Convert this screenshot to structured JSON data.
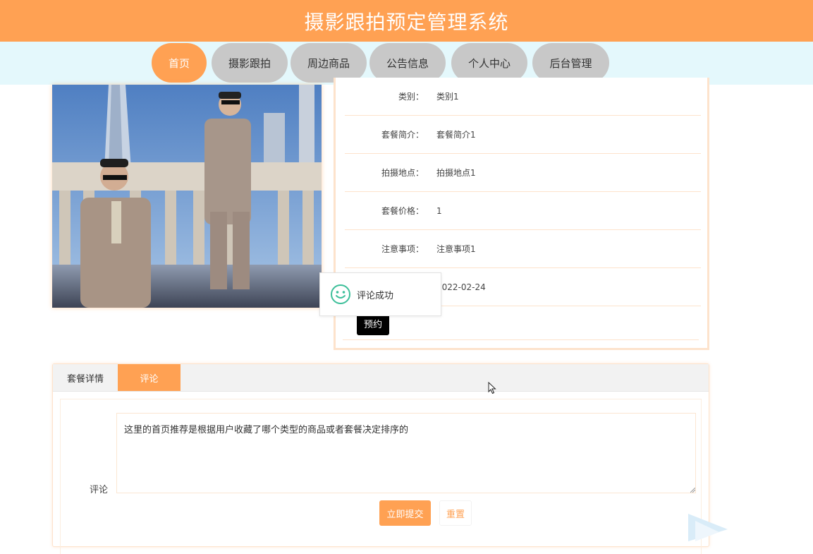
{
  "header": {
    "title": "摄影跟拍预定管理系统"
  },
  "nav": {
    "items": [
      {
        "label": "首页",
        "active": true
      },
      {
        "label": "摄影跟拍",
        "active": false
      },
      {
        "label": "周边商品",
        "active": false
      },
      {
        "label": "公告信息",
        "active": false
      },
      {
        "label": "个人中心",
        "active": false
      },
      {
        "label": "后台管理",
        "active": false
      }
    ]
  },
  "details": {
    "rows": [
      {
        "label": "类别：",
        "value": "类别1"
      },
      {
        "label": "套餐简介：",
        "value": "套餐简介1"
      },
      {
        "label": "拍摄地点：",
        "value": "拍摄地点1"
      },
      {
        "label": "套餐价格：",
        "value": "1"
      },
      {
        "label": "注意事项：",
        "value": "注意事项1"
      },
      {
        "label": "",
        "value": "2022-02-24"
      }
    ],
    "book_button": "预约"
  },
  "toast": {
    "message": "评论成功",
    "icon": "smile-icon"
  },
  "tabs": {
    "items": [
      {
        "label": "套餐详情",
        "active": false
      },
      {
        "label": "评论",
        "active": true
      }
    ]
  },
  "comment_form": {
    "label": "评论",
    "value": "这里的首页推荐是根据用户收藏了哪个类型的商品或者套餐决定排序的",
    "submit_label": "立即提交",
    "reset_label": "重置"
  },
  "colors": {
    "accent": "#ffa153",
    "nav_bg": "#e4f8fc",
    "nav_inactive": "#c8c8c8",
    "border": "#fde3cc"
  }
}
